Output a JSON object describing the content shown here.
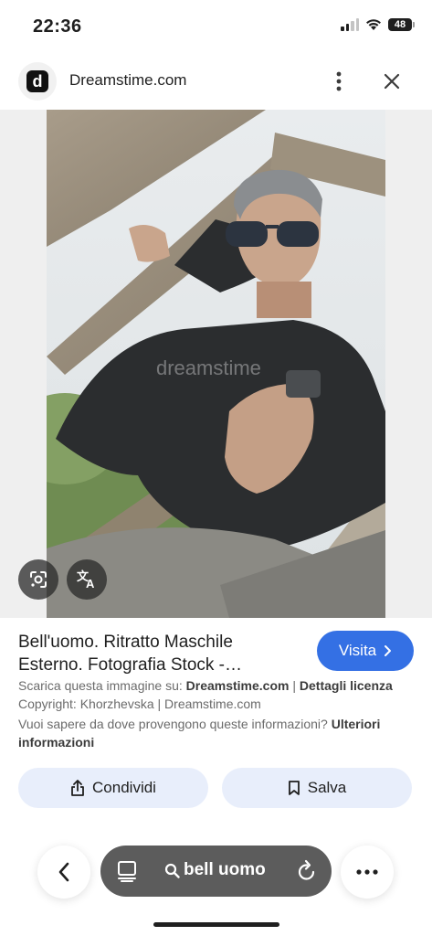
{
  "status_bar": {
    "time": "22:36",
    "battery": "48"
  },
  "header": {
    "site_name": "Dreamstime.com",
    "logo_letter": "d"
  },
  "image": {
    "alt": "Bell'uomo. Ritratto Maschile Esterno.",
    "watermark": "dreamstime"
  },
  "result": {
    "title": "Bell'uomo. Ritratto Maschile Esterno. Fotografia Stock -…",
    "visit_label": "Visita",
    "source_prefix": "Scarica questa immagine su: ",
    "source_site": "Dreamstime.com",
    "separator": " | ",
    "license_link": "Dettagli licenza",
    "copyright": "Copyright: Khorzhevska | Dreamstime.com",
    "info_question": "Vuoi sapere da dove provengono queste informazioni? ",
    "info_link": "Ulteriori informazioni"
  },
  "actions": {
    "share_label": "Condividi",
    "save_label": "Salva"
  },
  "bottom_nav": {
    "search_query": "bell uomo"
  },
  "colors": {
    "accent": "#3470e4",
    "action_bg": "#e8eefb",
    "pill_bg": "#5c5c5c"
  },
  "icons": [
    "dreamstime-logo",
    "more-vert-icon",
    "close-icon",
    "google-lens-icon",
    "translate-icon",
    "chevron-right-icon",
    "share-icon",
    "bookmark-icon",
    "back-icon",
    "tabs-icon",
    "search-icon",
    "refresh-icon",
    "more-horiz-icon"
  ]
}
